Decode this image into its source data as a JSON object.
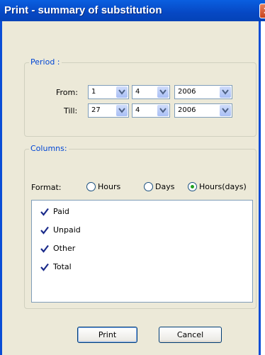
{
  "window": {
    "title": "Print - summary of substitution",
    "close_glyph": "✕"
  },
  "period": {
    "legend": "Period :",
    "from_label": "From:",
    "till_label": "Till:",
    "from": {
      "day": "1",
      "month": "4",
      "year": "2006"
    },
    "till": {
      "day": "27",
      "month": "4",
      "year": "2006"
    }
  },
  "columns": {
    "legend": "Columns:",
    "format_label": "Format:",
    "format_options": [
      {
        "label": "Hours",
        "selected": false
      },
      {
        "label": "Days",
        "selected": false
      },
      {
        "label": "Hours(days)",
        "selected": true
      }
    ],
    "items": [
      {
        "label": "Paid",
        "checked": true
      },
      {
        "label": "Unpaid",
        "checked": true
      },
      {
        "label": "Other",
        "checked": true
      },
      {
        "label": "Total",
        "checked": true
      }
    ]
  },
  "buttons": {
    "print": "Print",
    "cancel": "Cancel"
  },
  "colors": {
    "title_bar": "#0648c4",
    "legend_text": "#0046d5",
    "check": "#1a2a8a",
    "radio_dot": "#21a121"
  }
}
